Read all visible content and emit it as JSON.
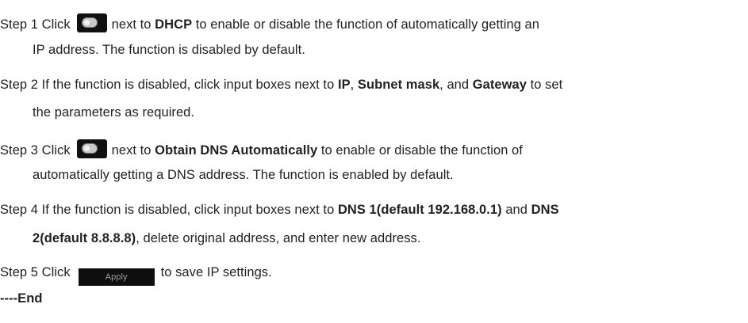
{
  "icons": {
    "toggle": "toggle-switch-icon"
  },
  "step1": {
    "prefix": "Step 1 Click",
    "after_toggle": "next to",
    "bold": "DHCP",
    "rest": "to enable or disable the function of automatically getting an",
    "line2": "IP address. The function is disabled by default."
  },
  "step2": {
    "prefix": "Step 2 If the function is disabled, click input boxes next to",
    "bold1": "IP",
    "sep1": ",",
    "bold2": "Subnet mask",
    "sep2": ", and",
    "bold3": "Gateway",
    "rest": "to set",
    "line2": "the parameters as required."
  },
  "step3": {
    "prefix": "Step 3 Click",
    "after_toggle": "next to",
    "bold": "Obtain DNS Automatically",
    "rest": "to enable or disable the function of",
    "line2": "automatically getting a DNS address. The function is enabled by default."
  },
  "step4": {
    "prefix": "Step 4 If the function is disabled, click input boxes next to",
    "bold1": "DNS 1(default 192.168.0.1)",
    "mid": "and",
    "bold2": "DNS",
    "line2_bold": "2(default 8.8.8.8)",
    "line2_rest": ", delete original address, and enter new address."
  },
  "step5": {
    "prefix": "Step 5 Click",
    "button_label": "Apply",
    "rest": "to save IP settings."
  },
  "end_marker": "----End"
}
